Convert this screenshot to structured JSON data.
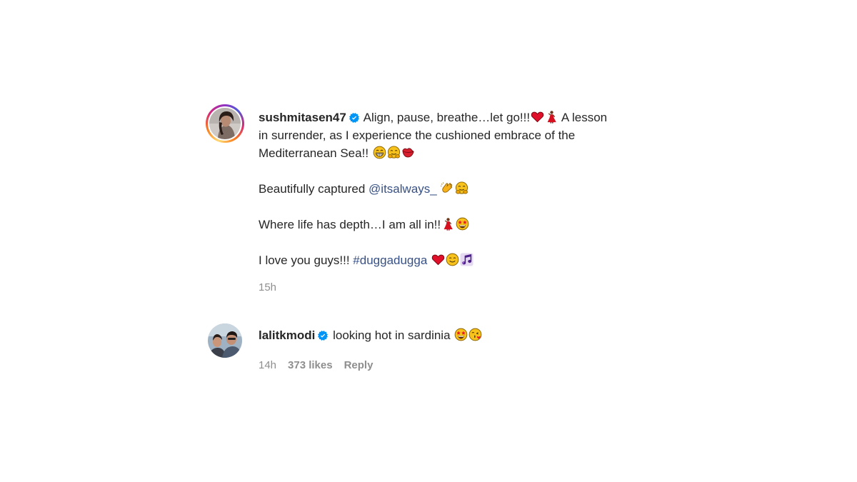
{
  "caption": {
    "username": "sushmitasen47",
    "line1_text": "Align, pause, breathe…let go!!!",
    "line1_tail": " A lesson",
    "line2_text": "in surrender, as I experience the cushioned embrace of the",
    "line3_text": "Mediterranean Sea!! ",
    "p2_text": "Beautifully captured ",
    "p2_mention": "@itsalways_",
    "p3_text": "Where life has depth…I am all in!!",
    "p4_text": "I love you guys!!! ",
    "p4_hashtag": "#duggadugga",
    "time": "15h",
    "icons": [
      "verified-badge-icon",
      "red-heart-icon",
      "dancer-icon",
      "grinning-face-icon",
      "hugging-face-icon",
      "kiss-mark-icon",
      "clapping-hands-icon",
      "star-struck-icon",
      "smiling-face-icon",
      "musical-notes-icon"
    ]
  },
  "reply": {
    "username": "lalitkmodi",
    "text": "looking hot in sardinia ",
    "time": "14h",
    "likes": "373 likes",
    "reply_label": "Reply",
    "icons": [
      "verified-badge-icon",
      "star-struck-icon",
      "face-blowing-kiss-icon"
    ]
  },
  "colors": {
    "text": "#262626",
    "secondary": "#8e8e8e",
    "link": "#385185",
    "verified": "#0095f6"
  }
}
